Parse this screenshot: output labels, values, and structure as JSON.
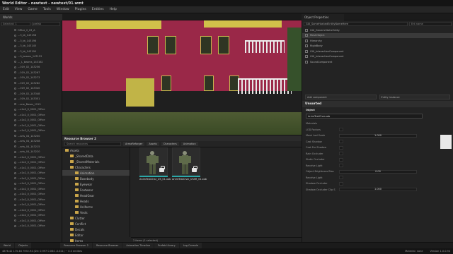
{
  "window": {
    "title": "World Editor - newtest - newtest/01.wmt"
  },
  "menu": [
    "Edit",
    "View",
    "Game",
    "Tools",
    "Window",
    "Plugins",
    "Entities",
    "Help"
  ],
  "left_panel": {
    "title": "Worlds",
    "filter_label": "Selected: 1",
    "search_placeholder": "prefab",
    "rows": [
      "Office_2_03_A",
      "...3_bt_143158",
      "...3_bt_143198",
      "...3_bt_143145",
      "...3_bt_143190",
      "...0_beams_143153",
      "..._L_beams_143162",
      "...019_02_143256",
      "...019_02_143267",
      "...019_02_143273",
      "...019_02_143282",
      "...019_02_143340",
      "...019_02_143348",
      "...019_02_143351",
      "...one_Bases_1915",
      "...x1x2_0_0001_Office",
      "...x1x2_0_0001_Office",
      "...x1x2_0_0001_Office",
      "...x1x2_0_0001_Office",
      "...x1x2_0_0001_Office",
      "...arts_04_143200",
      "...arts_04_143208",
      "...arts_04_143215",
      "...arts_04_143220",
      "...x1x2_0_0001_Office",
      "...x1x2_0_0001_Office",
      "...x1x2_0_0001_Office",
      "...x1x2_0_0001_Office",
      "...x1x2_0_0001_Office",
      "...x1x2_0_0001_Office",
      "...x1x2_0_0001_Office",
      "...x1x2_0_0001_Office",
      "...x1x2_0_0001_Office",
      "...x1x2_0_0001_Office",
      "...x1x2_0_0001_Office",
      "...x1x2_0_0001_Office",
      "...x1x2_0_0001_Office",
      "...x1x2_0_0001_Office"
    ]
  },
  "resource_browser": {
    "title": "Resource Browser 2",
    "search_placeholder": "Search resources",
    "breadcrumbs": [
      "ArmaReforger",
      "Assets",
      "Characters",
      "Animation"
    ],
    "tree": [
      {
        "label": "Assets",
        "depth": 0,
        "selected": false
      },
      {
        "label": "_SharedData",
        "depth": 1,
        "selected": false
      },
      {
        "label": "_SharedMaterials",
        "depth": 1,
        "selected": false
      },
      {
        "label": "Characters",
        "depth": 1,
        "selected": false
      },
      {
        "label": "Animation",
        "depth": 2,
        "selected": true
      },
      {
        "label": "Basebody",
        "depth": 2,
        "selected": false
      },
      {
        "label": "Eyewear",
        "depth": 2,
        "selected": false
      },
      {
        "label": "Footwear",
        "depth": 2,
        "selected": false
      },
      {
        "label": "HeadGear",
        "depth": 2,
        "selected": false
      },
      {
        "label": "Heads",
        "depth": 2,
        "selected": false
      },
      {
        "label": "Uniforms",
        "depth": 2,
        "selected": false
      },
      {
        "label": "Vests",
        "depth": 2,
        "selected": false
      },
      {
        "label": "Clutter",
        "depth": 1,
        "selected": false
      },
      {
        "label": "Conflict",
        "depth": 1,
        "selected": false
      },
      {
        "label": "Decals",
        "depth": 1,
        "selected": false
      },
      {
        "label": "Editor",
        "depth": 1,
        "selected": false
      },
      {
        "label": "Items",
        "depth": 1,
        "selected": false
      },
      {
        "label": "Props",
        "depth": 1,
        "selected": false
      },
      {
        "label": "Rocks",
        "depth": 1,
        "selected": false
      }
    ],
    "assets": [
      {
        "name": "AnimTestChar_US_01.xob"
      },
      {
        "name": "AnimTestChar_USSR_01.xob"
      }
    ],
    "status": "2 items (1 selected)"
  },
  "object_properties": {
    "title": "Object Properties",
    "entity_field": "GUI_SomeHashedEntityNameHere",
    "filter_field": "Ent name",
    "component_rows": [
      "GUI_GenericStaticEntity",
      "MeshObject",
      "Hierarchy",
      "RigidBody",
      "GUI_InteractionComponent",
      "GUI_InteractionComponent",
      "SoundComponent"
    ],
    "add_component_label": "Add component",
    "edit_instance_label": "Entity instance",
    "section_unsorted": "Unsorted",
    "object_label": "Object",
    "object_path": "AnimTestChar.xob",
    "materials_label": "Materials",
    "props": [
      {
        "label": "LOD Factors",
        "value": ""
      },
      {
        "label": "Mesh Lod Scale",
        "value": "1.000"
      },
      {
        "label": "Cast Shadow",
        "value": ""
      },
      {
        "label": "Cast Far Shadow",
        "value": ""
      },
      {
        "label": "Rain Occluder",
        "value": ""
      },
      {
        "label": "Static Occluder",
        "value": ""
      },
      {
        "label": "Receive Light",
        "value": ""
      },
      {
        "label": "Object Brightness Bias",
        "value": "0.00"
      },
      {
        "label": "Receive Light",
        "value": ""
      },
      {
        "label": "Shadow Occluder",
        "value": ""
      },
      {
        "label": "Shadow Occluder Clip S",
        "value": "1.000"
      }
    ]
  },
  "bottom_tabs": [
    "Resource Browser 2",
    "Resource Browser",
    "Animation Timeline",
    "Prefab Library",
    "Log Console"
  ],
  "world_tabs": [
    "World",
    "Objects"
  ],
  "status_bar": {
    "coords": "4876.42 175.48  7592.94 (Dir: 0.997 0.064 -0.021) ~ 0.0 entities",
    "camera": "Material: none",
    "version": "Version 1.0.0.94"
  }
}
